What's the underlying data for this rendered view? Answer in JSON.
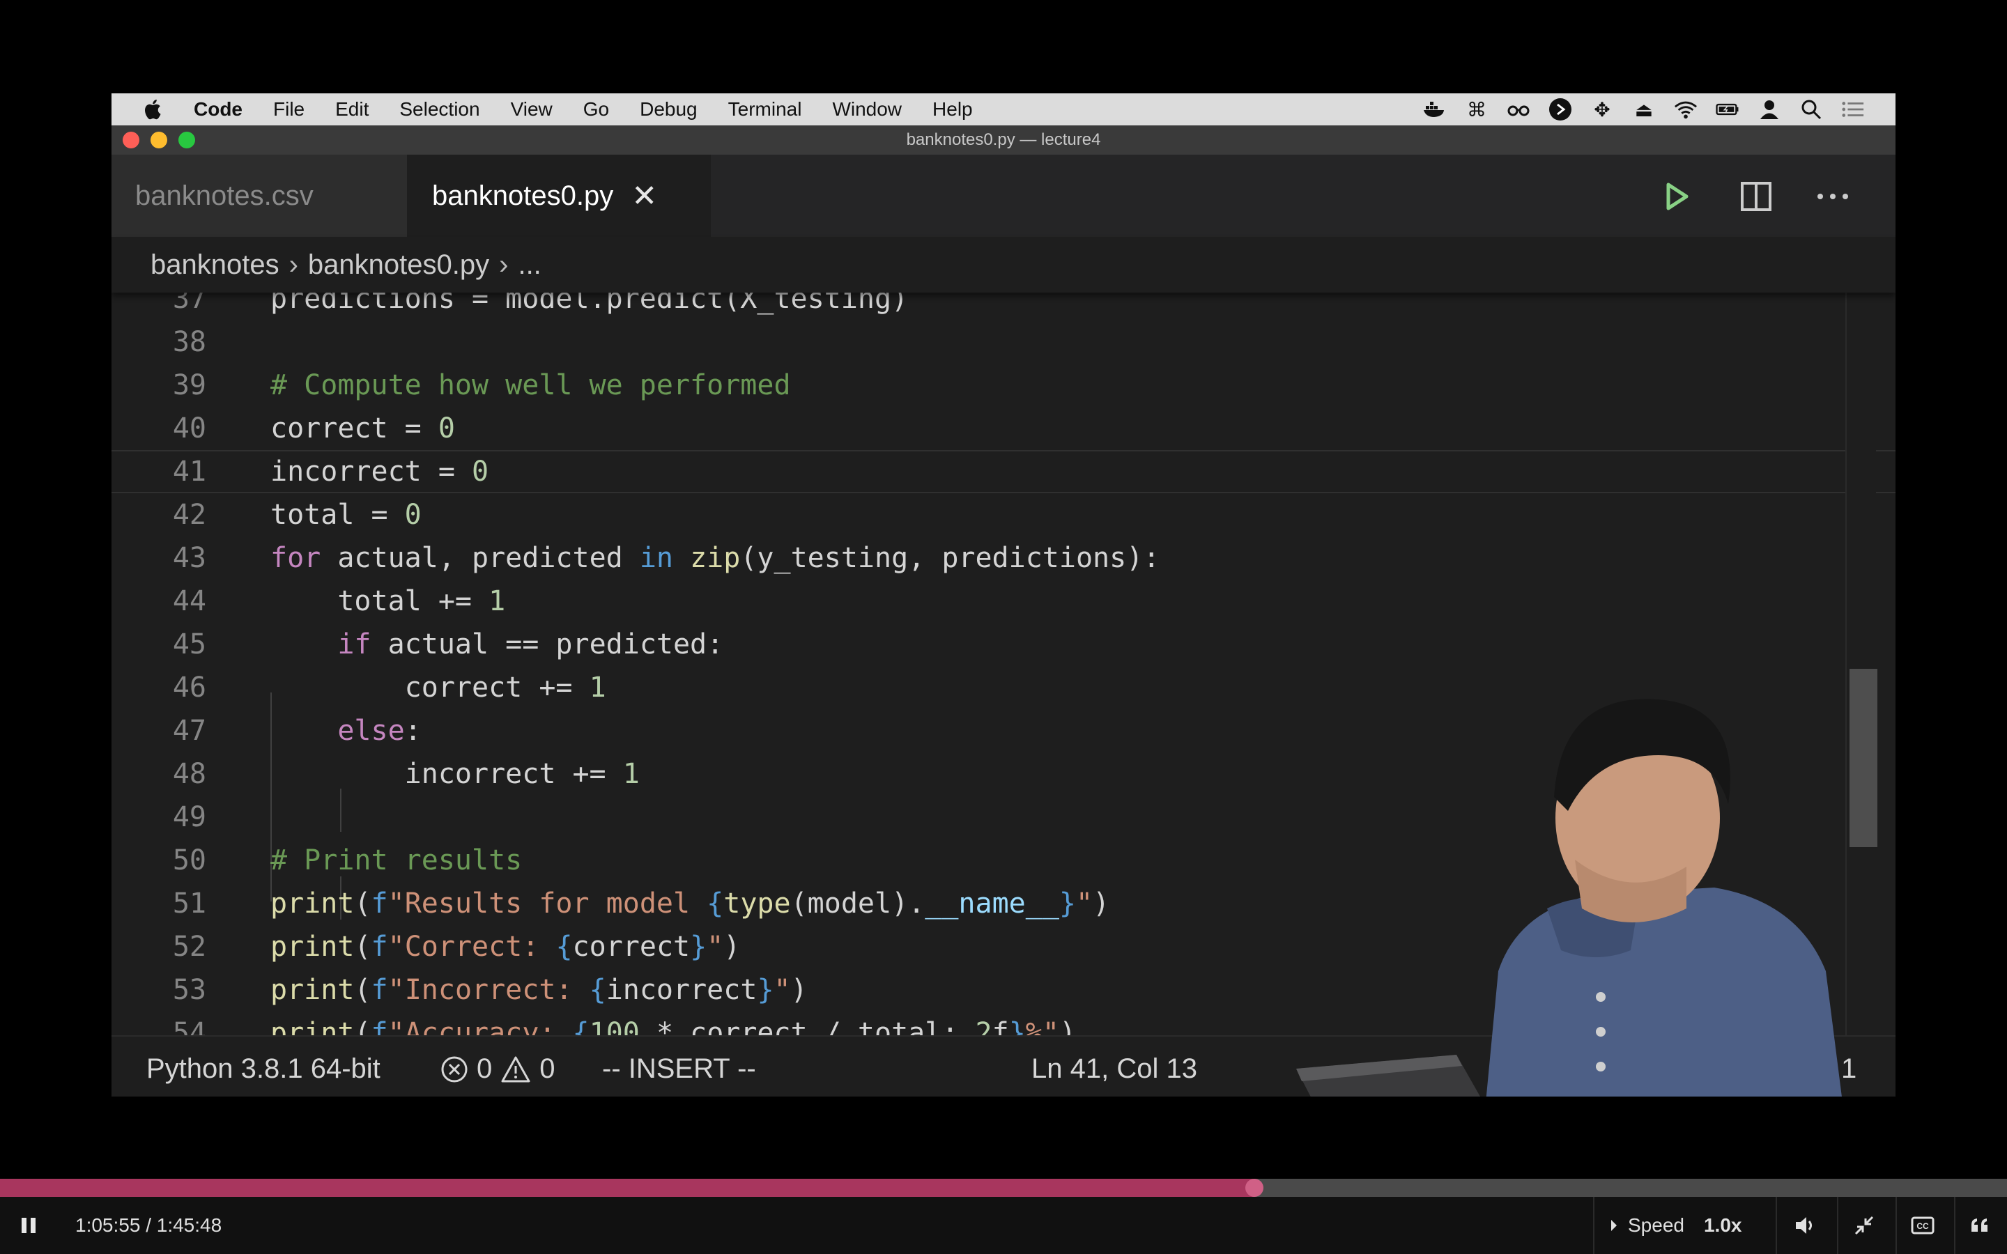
{
  "menubar": {
    "app_name": "Code",
    "items": [
      "File",
      "Edit",
      "Selection",
      "View",
      "Go",
      "Debug",
      "Terminal",
      "Window",
      "Help"
    ],
    "status_icons": [
      "docker-icon",
      "command-icon",
      "glasses-icon",
      "play-circle-icon",
      "move-icon",
      "eject-icon",
      "wifi-icon",
      "battery-icon",
      "user-icon",
      "search-icon",
      "list-icon"
    ]
  },
  "window": {
    "title": "banknotes0.py — lecture4",
    "traffic_colors": [
      "#fe5f57",
      "#febc2e",
      "#28c840"
    ]
  },
  "tabs": [
    {
      "label": "banknotes.csv",
      "active": false
    },
    {
      "label": "banknotes0.py",
      "active": true
    }
  ],
  "breadcrumb": [
    "banknotes",
    "banknotes0.py",
    "..."
  ],
  "editor": {
    "lines": [
      {
        "n": "37",
        "text": "predictions = model.predict(X_testing)"
      },
      {
        "n": "38",
        "text": ""
      },
      {
        "n": "39",
        "text": "# Compute how well we performed"
      },
      {
        "n": "40",
        "text": "correct = 0"
      },
      {
        "n": "41",
        "text": "incorrect = 0"
      },
      {
        "n": "42",
        "text": "total = 0"
      },
      {
        "n": "43",
        "text": "for actual, predicted in zip(y_testing, predictions):"
      },
      {
        "n": "44",
        "text": "    total += 1"
      },
      {
        "n": "45",
        "text": "    if actual == predicted:"
      },
      {
        "n": "46",
        "text": "        correct += 1"
      },
      {
        "n": "47",
        "text": "    else:"
      },
      {
        "n": "48",
        "text": "        incorrect += 1"
      },
      {
        "n": "49",
        "text": ""
      },
      {
        "n": "50",
        "text": "# Print results"
      },
      {
        "n": "51",
        "text": "print(f\"Results for model {type(model).__name__}\")"
      },
      {
        "n": "52",
        "text": "print(f\"Correct: {correct}\")"
      },
      {
        "n": "53",
        "text": "print(f\"Incorrect: {incorrect}\")"
      },
      {
        "n": "54",
        "text": "print(f\"Accuracy: {100 * correct / total:.2f}%\")"
      }
    ],
    "current_line": "41"
  },
  "statusbar": {
    "interpreter": "Python 3.8.1 64-bit",
    "errors": "0",
    "warnings": "0",
    "mode": "-- INSERT --",
    "position": "Ln 41, Col 13",
    "notifications": "1"
  },
  "player": {
    "time": "1:05:55 / 1:45:48",
    "progress": 0.625,
    "speed_label": "Speed",
    "speed_value": "1.0x",
    "accent": "#a8365e"
  }
}
